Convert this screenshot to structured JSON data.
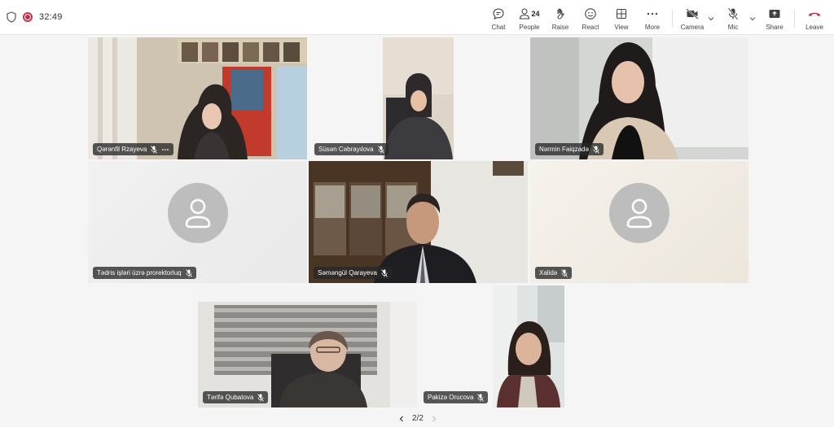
{
  "meeting": {
    "timer": "32:49"
  },
  "toolbar": {
    "chat": "Chat",
    "people": "People",
    "people_count": "24",
    "raise": "Raise",
    "react": "React",
    "view": "View",
    "more": "More",
    "camera": "Camera",
    "mic": "Mic",
    "share": "Share",
    "leave": "Leave"
  },
  "participants": [
    {
      "name": "Qərənfil Rzayeva",
      "video": true
    },
    {
      "name": "Süsən Cəbrayılova",
      "video": true
    },
    {
      "name": "Nərmin Faiqzadə",
      "video": true
    },
    {
      "name": "Tədris işləri üzrə prorektorluq",
      "video": false
    },
    {
      "name": "Səməngül Qarayeva",
      "video": true
    },
    {
      "name": "Xalidə",
      "video": false
    },
    {
      "name": "Tərifə Qubatova",
      "video": true
    },
    {
      "name": "Pakizə Orucova",
      "video": true
    }
  ],
  "pagination": {
    "label": "2/2"
  },
  "colors": {
    "recording": "#c4314b",
    "leave": "#c4314b",
    "avatar_bg": "#bdbdbd"
  }
}
